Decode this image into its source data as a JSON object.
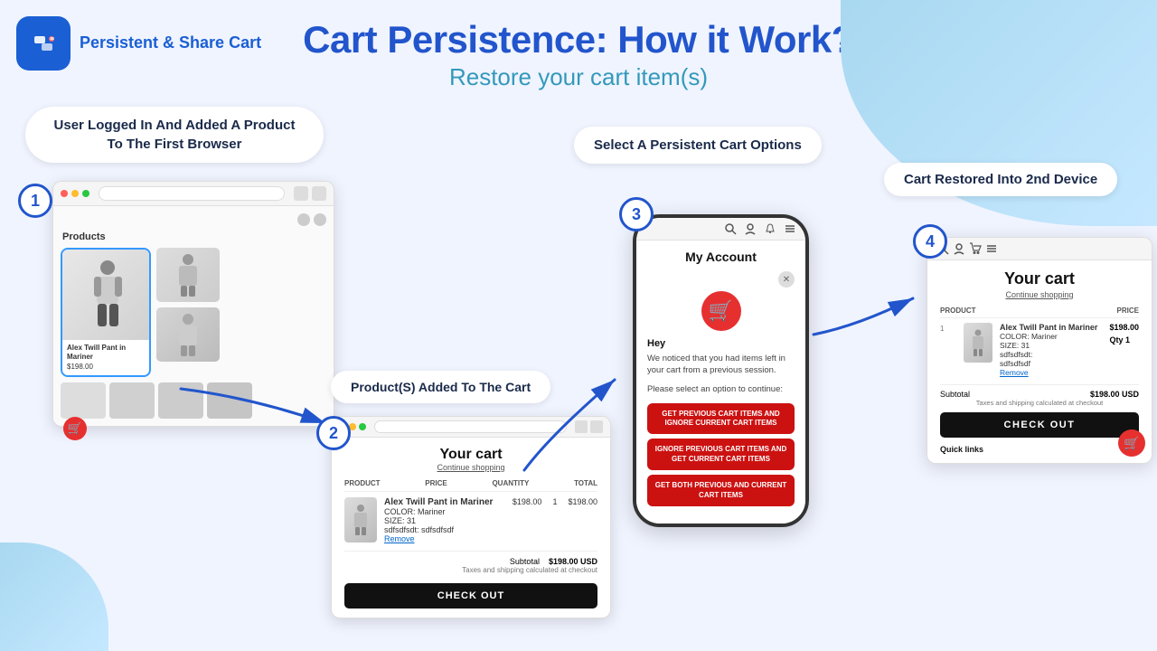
{
  "page": {
    "title": "Cart Persistence: How it Work?",
    "subtitle": "Restore your cart item(s)",
    "background_color": "#f0f4ff"
  },
  "logo": {
    "text": "Persistent &\nShare Cart",
    "icon": "🔗"
  },
  "step1": {
    "badge": "1",
    "label": "User Logged In And Added A Product To The First Browser",
    "product_name": "Alex Twill Pant in Mariner",
    "price": "$198.00"
  },
  "step2": {
    "badge": "2",
    "label": "Product(S) Added To The Cart",
    "cart_title": "Your cart",
    "cart_subtitle": "Continue shopping",
    "columns": [
      "PRODUCT",
      "PRICE",
      "QUANTITY",
      "TOTAL"
    ],
    "item_name": "Alex Twill Pant in Mariner",
    "item_color": "COLOR: Mariner",
    "item_size": "SIZE: 31",
    "item_sku": "sdfsdfsdt: sdfsdfsdf",
    "item_price": "$198.00",
    "item_qty": "1",
    "item_total": "$198.00",
    "remove_label": "Remove",
    "subtotal_label": "Subtotal",
    "subtotal_value": "$198.00 USD",
    "taxes_note": "Taxes and shipping calculated at checkout",
    "checkout_label": "CHECK OUT"
  },
  "step3": {
    "badge": "3",
    "label_top": "Select A Persistent Cart Options",
    "account_title": "My Account",
    "hey": "Hey",
    "message": "We noticed that you had items left in your cart from a previous session.",
    "select_msg": "Please select an option to continue:",
    "btn1": "GET PREVIOUS CART ITEMS AND IGNORE CURRENT CART ITEMS",
    "btn2": "IGNORE PREVIOUS CART ITEMS AND GET CURRENT CART ITEMS",
    "btn3": "GET BOTH PREVIOUS AND CURRENT CART ITEMS"
  },
  "step4": {
    "badge": "4",
    "label": "Cart Restored Into 2nd Device",
    "cart_title": "Your cart",
    "cart_subtitle": "Continue shopping",
    "columns": [
      "PRODUCT",
      "PRICE"
    ],
    "item_name": "Alex Twill Pant in Mariner",
    "item_color": "COLOR: Mariner",
    "item_size": "SIZE: 31",
    "item_extra": "sdfsdfsdt:",
    "item_extra2": "sdfsdfsdf",
    "item_price": "$198.00",
    "item_qty_label": "Qty",
    "item_qty": "1",
    "remove_label": "Remove",
    "subtotal_label": "Subtotal",
    "subtotal_value": "$198.00 USD",
    "taxes_note": "Taxes and shipping calculated at checkout",
    "checkout_label": "CHECK OUT",
    "quick_links": "Quick links"
  },
  "icons": {
    "cart": "🛒",
    "person": "👤",
    "share": "🔗",
    "close": "✕"
  }
}
